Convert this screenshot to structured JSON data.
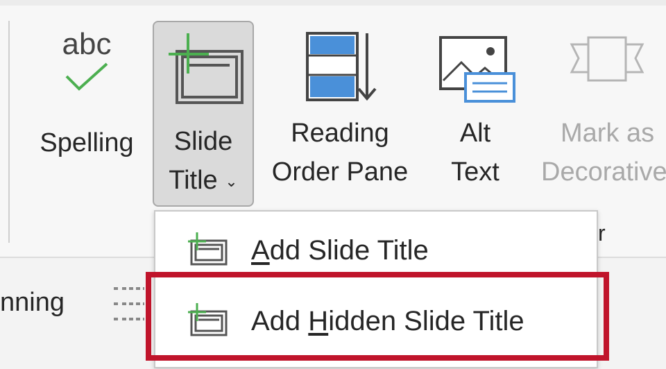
{
  "ribbon": {
    "buttons": {
      "spelling": {
        "icon_text": "abc",
        "label": "Spelling"
      },
      "slide_title": {
        "line1": "Slide",
        "line2": "Title",
        "chevron": "⌄"
      },
      "reading_order": {
        "line1": "Reading",
        "line2": "Order Pane"
      },
      "alt_text": {
        "line1": "Alt",
        "line2": "Text"
      },
      "mark_decorative": {
        "line1": "Mark as",
        "line2": "Decorative"
      }
    },
    "group_label_fragment": "r",
    "left_group_fragment": "nning"
  },
  "menu": {
    "items": [
      {
        "mnemonic": "A",
        "rest": "dd Slide Title"
      },
      {
        "prefix": "Add ",
        "mnemonic": "H",
        "rest": "idden Slide Title"
      }
    ]
  },
  "colors": {
    "highlight": "#c0142b",
    "icon_green": "#4caf50",
    "icon_blue": "#4a90d9"
  }
}
